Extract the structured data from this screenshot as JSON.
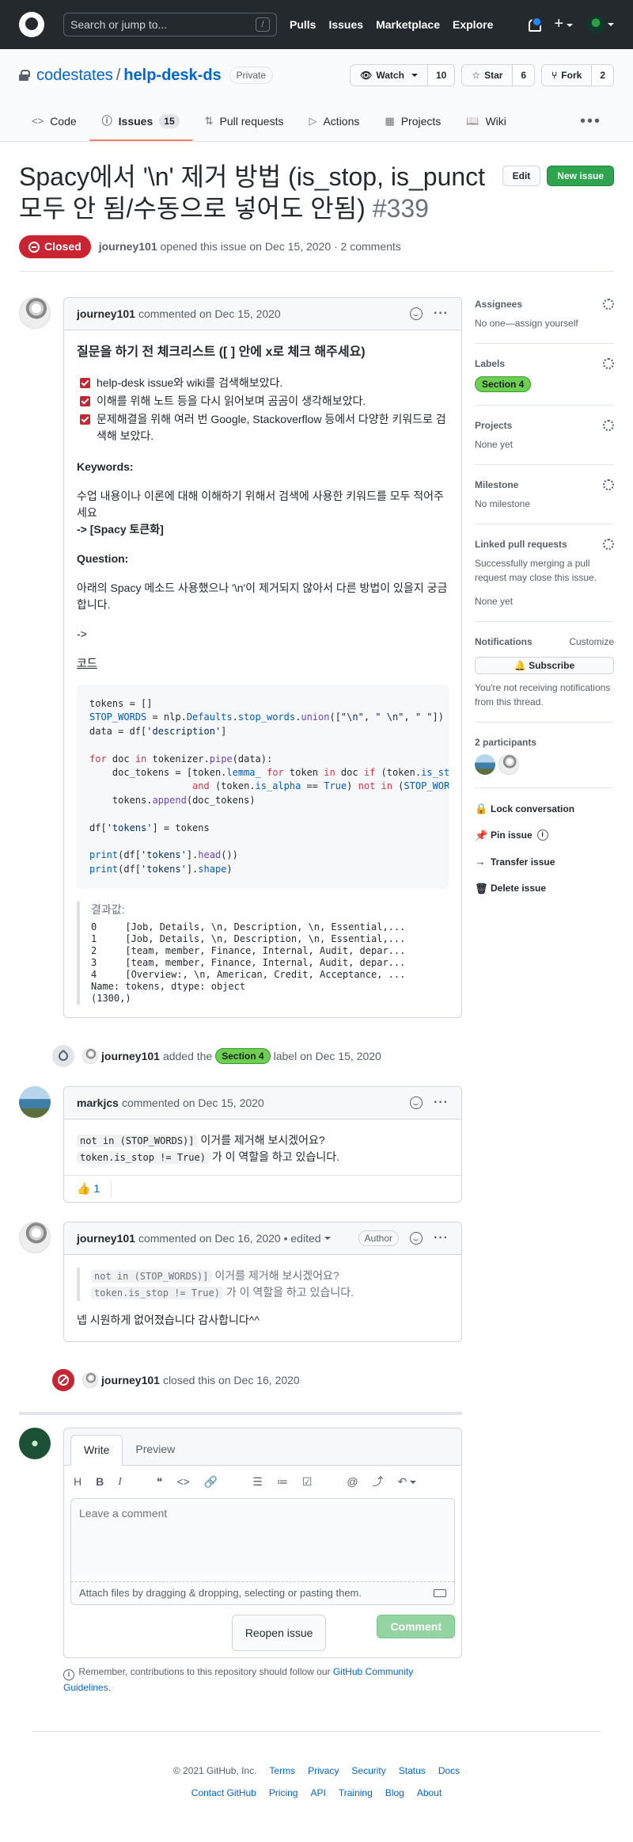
{
  "header": {
    "search_placeholder": "Search or jump to...",
    "search_shortcut": "/",
    "nav": [
      "Pulls",
      "Issues",
      "Marketplace",
      "Explore"
    ]
  },
  "repo": {
    "owner": "codestates",
    "name": "help-desk-ds",
    "visibility": "Private",
    "watch_label": "Watch",
    "watch_count": "10",
    "star_label": "Star",
    "star_count": "6",
    "fork_label": "Fork",
    "fork_count": "2",
    "tabs": [
      {
        "label": "Code",
        "icon": "code-icon"
      },
      {
        "label": "Issues",
        "icon": "issue-icon",
        "count": "15"
      },
      {
        "label": "Pull requests",
        "icon": "pull-request-icon"
      },
      {
        "label": "Actions",
        "icon": "play-icon"
      },
      {
        "label": "Projects",
        "icon": "project-icon"
      },
      {
        "label": "Wiki",
        "icon": "book-icon"
      }
    ]
  },
  "issue": {
    "title": "Spacy에서 '\\n' 제거 방법 (is_stop, is_punct 모두 안 됨/수동으로 넣어도 안됨)",
    "number": "#339",
    "edit_label": "Edit",
    "new_issue_label": "New issue",
    "state": "Closed",
    "author": "journey101",
    "opened_text": "opened this issue on Dec 15, 2020 · 2 comments"
  },
  "comments": [
    {
      "author": "journey101",
      "date_text": "commented on Dec 15, 2020",
      "heading": "질문을 하기 전 체크리스트 ([ ] 안에 x로 체크 해주세요)",
      "checks": [
        "help-desk issue와 wiki를 검색해보았다.",
        "이해를 위해 노트 등을 다시 읽어보며 곰곰이 생각해보았다.",
        "문제해결을 위해 여러 번 Google, Stackoverflow 등에서 다양한 키워드로 검색해 보았다."
      ],
      "keywords_title": "Keywords:",
      "keywords_text": "수업 내용이나 이론에 대해 이해하기 위해서 검색에 사용한 키워드를 모두 적어주세요",
      "keywords_value": "-> [Spacy 토큰화]",
      "question_title": "Question:",
      "question_text": "아래의 Spacy 메소드 사용했으나 '\\n'이 제거되지 않아서 다른 방법이 있을지 궁금합니다.",
      "arrow": "->",
      "code_label": "코드",
      "result_label": "결과값:",
      "result_lines": [
        "0     [Job, Details, \\n, Description, \\n, Essential,...",
        "1     [Job, Details, \\n, Description, \\n, Essential,...",
        "2     [team, member, Finance, Internal, Audit, depar...",
        "3     [team, member, Finance, Internal, Audit, depar...",
        "4     [Overview:, \\n, American, Credit, Acceptance, ...",
        "Name: tokens, dtype: object",
        "(1300,)"
      ]
    },
    {
      "author": "markjcs",
      "date_text": "commented on Dec 15, 2020",
      "code1": "not in (STOP_WORDS)]",
      "text1": " 이거를 제거해 보시겠어요?",
      "code2": "token.is_stop != True)",
      "text2": " 가 이 역할을 하고 있습니다.",
      "reaction_emoji": "👍",
      "reaction_count": "1"
    },
    {
      "author": "journey101",
      "date_text": "commented on Dec 16, 2020 • edited",
      "badge": "Author",
      "quote_code1": "not in (STOP_WORDS)]",
      "quote_text1": " 이거를 제거해 보시겠어요?",
      "quote_code2": "token.is_stop != True)",
      "quote_text2": " 가 이 역할을 하고 있습니다.",
      "reply": "넵 시원하게 없어졌습니다 감사합니다^^"
    }
  ],
  "events": {
    "label_event": {
      "actor": "journey101",
      "pre": "added the",
      "label": "Section 4",
      "post": "label on Dec 15, 2020"
    },
    "close_event": {
      "actor": "journey101",
      "text": "closed this on Dec 16, 2020"
    }
  },
  "new_comment": {
    "tab_write": "Write",
    "tab_preview": "Preview",
    "toolbar": [
      "H",
      "B",
      "I"
    ],
    "placeholder": "Leave a comment",
    "attach_text": "Attach files by dragging & dropping, selecting or pasting them.",
    "reopen_label": "Reopen issue",
    "comment_label": "Comment",
    "remember_pre": "Remember, contributions to this repository should follow our ",
    "remember_link": "GitHub Community Guidelines",
    "remember_post": "."
  },
  "sidebar": {
    "assignees_title": "Assignees",
    "assignees_value": "No one—assign yourself",
    "labels_title": "Labels",
    "label": "Section 4",
    "projects_title": "Projects",
    "projects_value": "None yet",
    "milestone_title": "Milestone",
    "milestone_value": "No milestone",
    "linked_title": "Linked pull requests",
    "linked_desc": "Successfully merging a pull request may close this issue.",
    "linked_value": "None yet",
    "notifications_title": "Notifications",
    "customize": "Customize",
    "subscribe_label": "Subscribe",
    "notif_desc": "You're not receiving notifications from this thread.",
    "participants_title": "2 participants",
    "actions": [
      "Lock conversation",
      "Pin issue",
      "Transfer issue",
      "Delete issue"
    ]
  },
  "footer": {
    "copyright": "© 2021 GitHub, Inc.",
    "row1": [
      "Terms",
      "Privacy",
      "Security",
      "Status",
      "Docs"
    ],
    "row2": [
      "Contact GitHub",
      "Pricing",
      "API",
      "Training",
      "Blog",
      "About"
    ]
  },
  "colors": {
    "closed": "#cb2431",
    "primary": "#2ea44f",
    "label": "#6ccf4f",
    "link": "#0366d6"
  }
}
